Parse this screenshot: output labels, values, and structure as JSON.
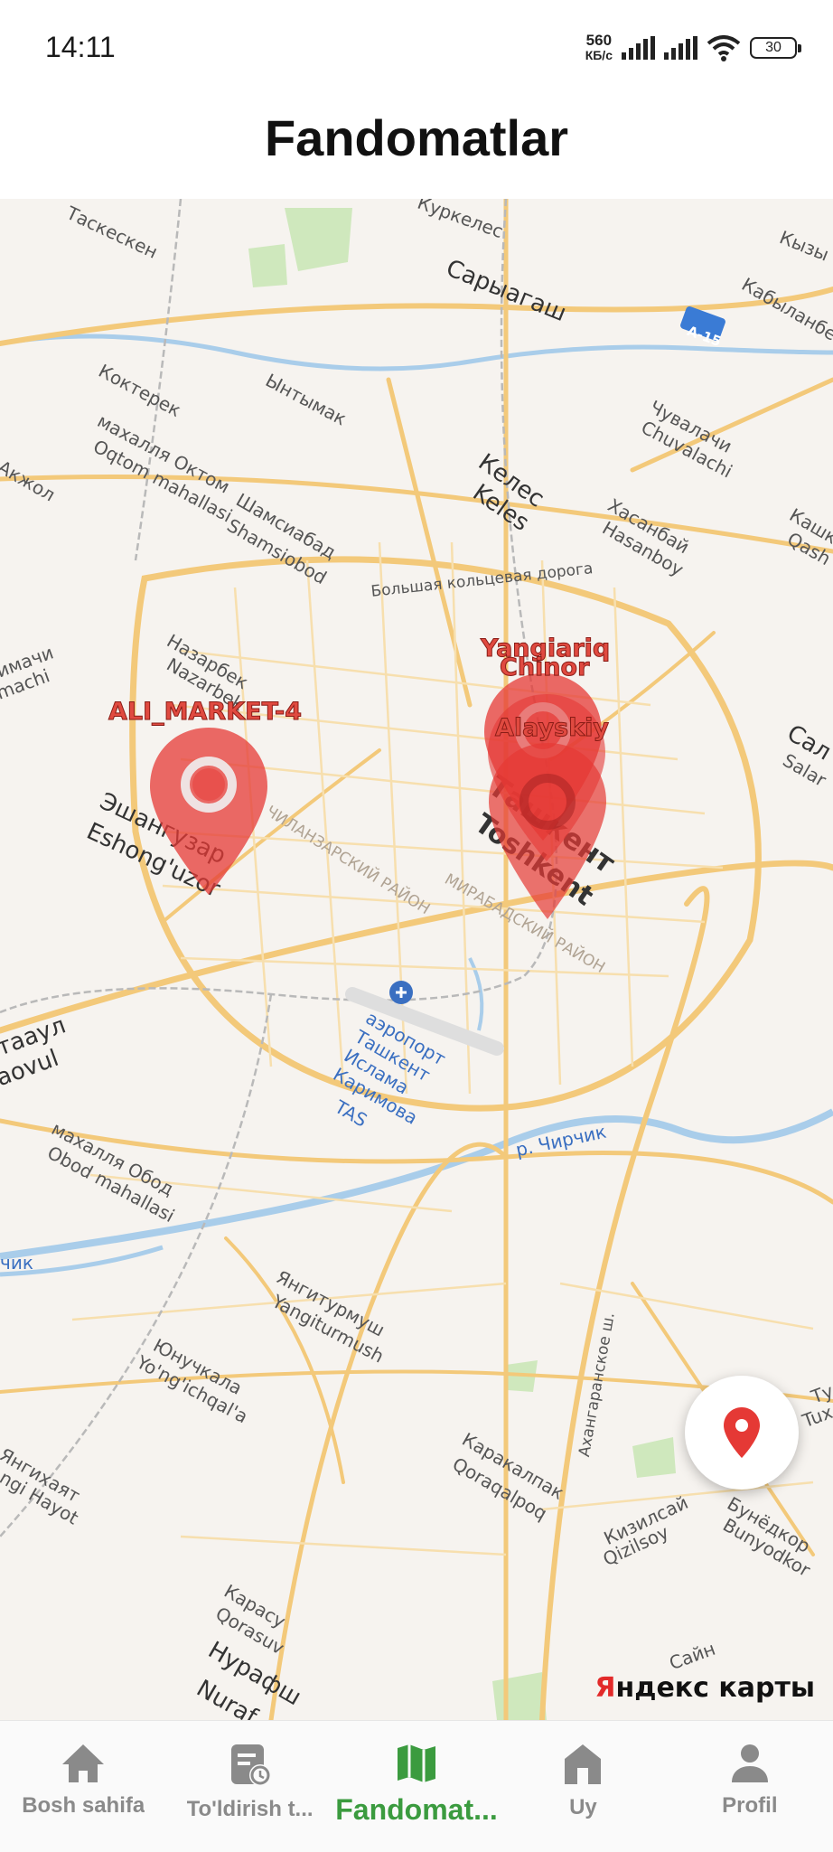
{
  "status_bar": {
    "time": "14:11",
    "net_speed_value": "560",
    "net_speed_unit": "КБ/с",
    "battery": "30"
  },
  "header": {
    "title": "Fandomatlar"
  },
  "map": {
    "provider_logo_prefix": "Я",
    "provider_logo_rest": "ндекс карты",
    "labels": {
      "taskesken": "Таскескен",
      "kurkeles": "Куркелес",
      "sarygash": "Сарыагаш",
      "kyzyl": "Кызы",
      "kabylan": "Кабыланбе",
      "a15": "А-15",
      "kokterek": "Коктерек",
      "yntymak": "Ынтымак",
      "oktom_ru": "махалля Октом",
      "oktom_uz": "Oqtom mahallasi",
      "chuvalachi_ru": "Чувалачи",
      "chuvalachi_uz": "Chuvalachi",
      "akzhol": "Акжол",
      "keles_ru": "Келес",
      "keles_uz": "Keles",
      "shamsiabad_ru": "Шамсиабад",
      "shamsiabad_uz": "Shamsiobod",
      "hasanbay_ru": "Хасанбай",
      "hasanbay_uz": "Hasanboy",
      "kashk": "Кашк",
      "qash": "Qash",
      "ring_road": "Большая кольцевая дорога",
      "imachi_ru": "имачи",
      "imachi_uz": "machi",
      "nazarbek_ru": "Назарбек",
      "nazarbek_uz": "Nazarbek",
      "sal": "Сал",
      "salar": "Salar",
      "eshonguzar_ru": "Эшангузар",
      "eshonguzar_uz": "Eshong'uzor",
      "chilanzar": "ЧИЛАНЗАРСКИЙ РАЙОН",
      "tashkent_ru": "Ташкент",
      "tashkent_uz": "Toshkent",
      "mirabad": "МИРАБАДСКИЙ РАЙОН",
      "airport_ru": "аэропорт Ташкент Ислама Каримова",
      "airport_code": "TAS",
      "taaul_ru": "таaул",
      "taaul_uz": "aovul",
      "chirchik": "р. Чирчик",
      "obod_ru": "махалля Обод",
      "obod_uz": "Obod mahallasi",
      "chik": "чик",
      "yangiturmush_ru": "Янгитурмуш",
      "yangiturmush_uz": "Yangiturmush",
      "yunuchkala_ru": "Юнучкала",
      "yunuchkala_uz": "Yo'ng'ichqal'a",
      "akhangaran_sh": "Ахангаранское ш.",
      "tu": "Ту",
      "tux": "Tux",
      "yangikhayat_ru": "Янгихаят",
      "yangikhayat_uz": "ngi Hayot",
      "karakalpak_ru": "Каракалпак",
      "karakalpak_uz": "Qoraqalpoq",
      "kizilsay_ru": "Кизилсай",
      "kizilsay_uz": "Qizilsoy",
      "bunyodkor_ru": "Бунёдкор",
      "bunyodkor_uz": "Bunyodkor",
      "karasu_ru": "Карасу",
      "karasu_uz": "Qorasuv",
      "nurafshon_ru": "Нурафш",
      "nurafshon_uz": "Nuraf",
      "sain": "Сайн"
    },
    "markers": [
      {
        "label": "ALI_MARKET-4"
      },
      {
        "label": "Yangiariq"
      },
      {
        "label": "Chinor"
      },
      {
        "label": "Alayskiy"
      }
    ],
    "marker_color": "#e53935"
  },
  "nav": {
    "items": [
      {
        "label": "Bosh sahifa",
        "icon": "home-icon"
      },
      {
        "label": "To'ldirish t...",
        "icon": "payment-history-icon"
      },
      {
        "label": "Fandomat...",
        "icon": "map-icon"
      },
      {
        "label": "Uy",
        "icon": "house-icon"
      },
      {
        "label": "Profil",
        "icon": "person-icon"
      }
    ],
    "active_color": "#3b9b3f",
    "inactive_color": "#8a8a8a"
  }
}
